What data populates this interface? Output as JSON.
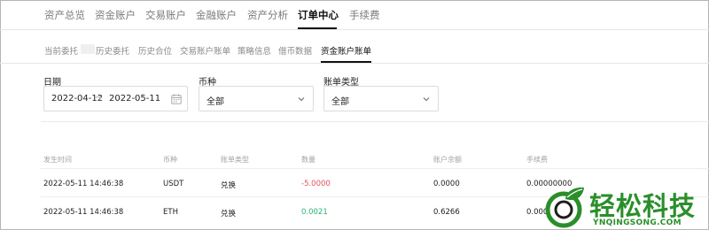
{
  "colors": {
    "negative": "#e4505f",
    "positive": "#27b573",
    "watermark": "#2a8f2a"
  },
  "topnav": {
    "items": [
      "资产总览",
      "资金账户",
      "交易账户",
      "金融账户",
      "资产分析",
      "订单中心",
      "手续费"
    ],
    "active_index": 5
  },
  "subtabs": {
    "items": [
      "当前委托",
      "历史委托",
      "历史合位",
      "交易账户账单",
      "策略信息",
      "借币数据",
      "资金账户账单"
    ],
    "active_index": 6
  },
  "filters": {
    "date": {
      "label": "日期",
      "start": "2022-04-12",
      "arrow": "→",
      "end": "2022-05-11",
      "icon": "calendar-icon"
    },
    "currency": {
      "label": "币种",
      "value": "全部",
      "icon": "chevron-down-icon"
    },
    "bill_type": {
      "label": "账单类型",
      "value": "全部",
      "icon": "chevron-down-icon"
    }
  },
  "table": {
    "columns": [
      "发生时间",
      "币种",
      "账单类型",
      "数量",
      "账户余额",
      "手续费"
    ],
    "rows": [
      {
        "time": "2022-05-11 14:46:38",
        "currency": "USDT",
        "type": "兑换",
        "amount": "-5.0000",
        "balance": "0.0000",
        "fee": "0.00000000"
      },
      {
        "time": "2022-05-11 14:46:38",
        "currency": "ETH",
        "type": "兑换",
        "amount": "0.0021",
        "balance": "0.6266",
        "fee": "0.0000"
      }
    ]
  },
  "watermark": {
    "title": "轻松科技",
    "subtitle": "YNQINGSONG.COM"
  }
}
